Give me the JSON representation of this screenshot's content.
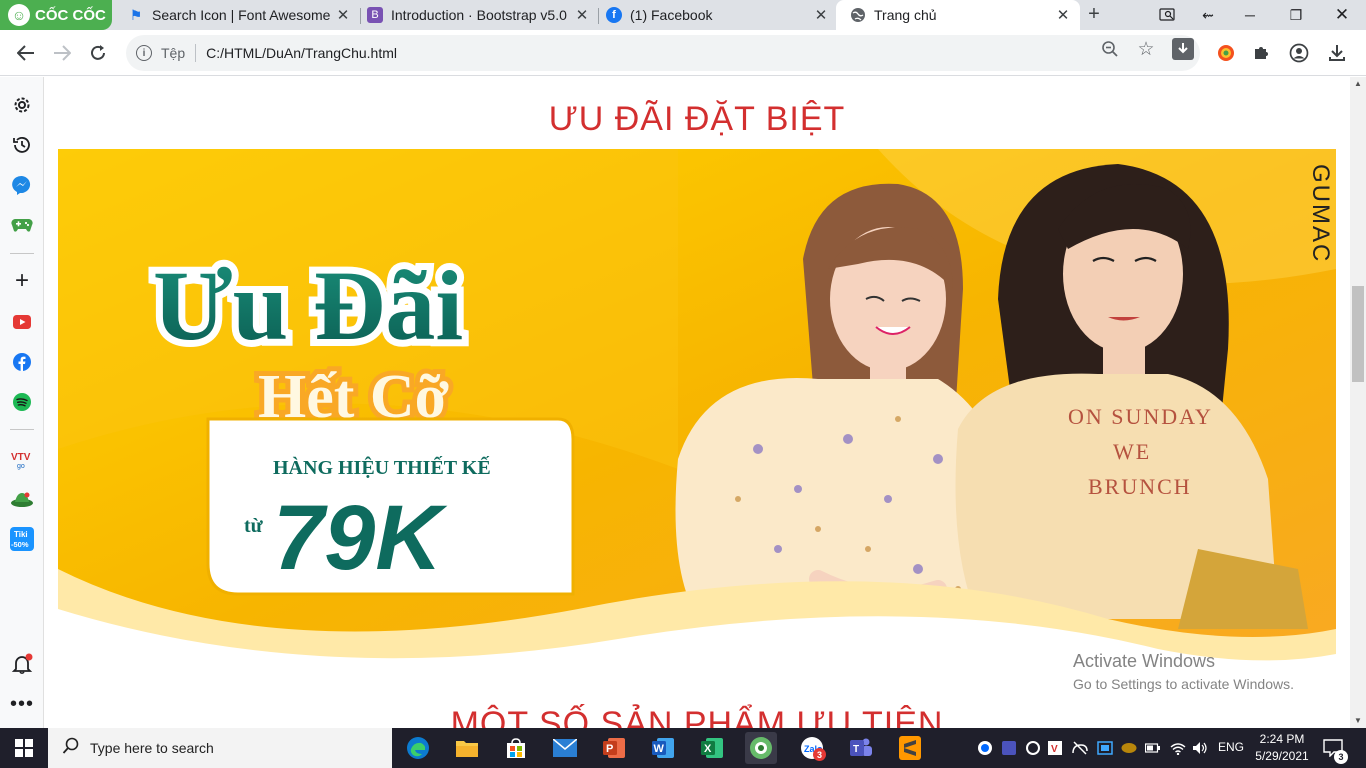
{
  "browser": {
    "brand": "CỐC CỐC",
    "tabs": [
      {
        "title": "Search Icon | Font Awesome",
        "icon": "flag-icon"
      },
      {
        "title": "Introduction · Bootstrap v5.0",
        "icon": "bootstrap-icon",
        "icon_glyph": "B"
      },
      {
        "title": "(1) Facebook",
        "icon": "facebook-icon",
        "icon_glyph": "f"
      },
      {
        "title": "Trang chủ",
        "icon": "globe-icon"
      }
    ],
    "new_tab": "+",
    "address": {
      "scheme_label": "Tệp",
      "url": "C:/HTML/DuAn/TrangChu.html"
    }
  },
  "page": {
    "heading_offers": "ƯU ĐÃI ĐẶT BIỆT",
    "heading_products": "MỘT SỐ SẢN PHẨM ƯU TIÊN",
    "banner": {
      "line1": "Ưu Đãi",
      "line2": "Hết Cỡ",
      "tagline": "HÀNG HIỆU THIẾT KẾ",
      "from": "từ",
      "price": "79K",
      "brand_logo": "GUMAC",
      "shirt_print": [
        "ON SUNDAY",
        "WE",
        "BRUNCH"
      ]
    }
  },
  "watermark": {
    "line1": "Activate Windows",
    "line2": "Go to Settings to activate Windows."
  },
  "taskbar": {
    "search_placeholder": "Type here to search",
    "zalo_badge": "3",
    "language": "ENG",
    "time": "2:24 PM",
    "date": "5/29/2021",
    "notification_count": "3"
  },
  "colors": {
    "heading_red": "#d32f2f",
    "banner_yellow": "#f7b500",
    "banner_teal": "#0e6b5e",
    "coccoc_green": "#4caf50"
  }
}
